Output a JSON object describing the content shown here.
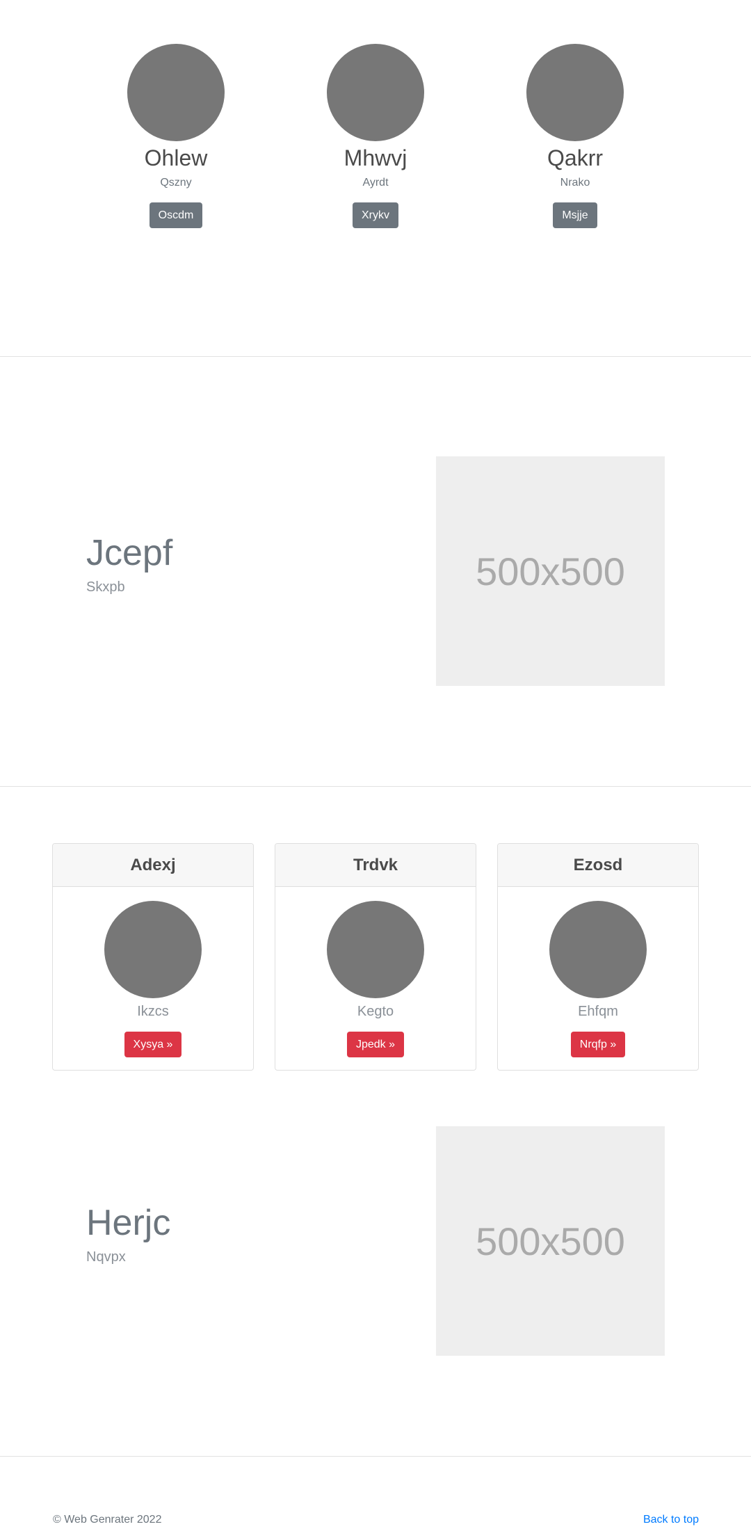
{
  "people": [
    {
      "name": "Ohlew",
      "subtitle": "Qszny",
      "button": "Oscdm"
    },
    {
      "name": "Mhwvj",
      "subtitle": "Ayrdt",
      "button": "Xrykv"
    },
    {
      "name": "Qakrr",
      "subtitle": "Nrako",
      "button": "Msjje"
    }
  ],
  "featurette1": {
    "title": "Jcepf",
    "subtitle": "Skxpb",
    "image_label": "500x500"
  },
  "cards": [
    {
      "title": "Adexj",
      "subtitle": "Ikzcs",
      "button": "Xysya »"
    },
    {
      "title": "Trdvk",
      "subtitle": "Kegto",
      "button": "Jpedk »"
    },
    {
      "title": "Ezosd",
      "subtitle": "Ehfqm",
      "button": "Nrqfp »"
    }
  ],
  "featurette2": {
    "title": "Herjc",
    "subtitle": "Nqvpx",
    "image_label": "500x500"
  },
  "footer": {
    "copyright": "© Web Genrater 2022",
    "back_to_top": "Back to top"
  },
  "colors": {
    "avatar": "#777777",
    "secondary_button": "#6c757d",
    "danger_button": "#dc3545",
    "link": "#007bff"
  }
}
